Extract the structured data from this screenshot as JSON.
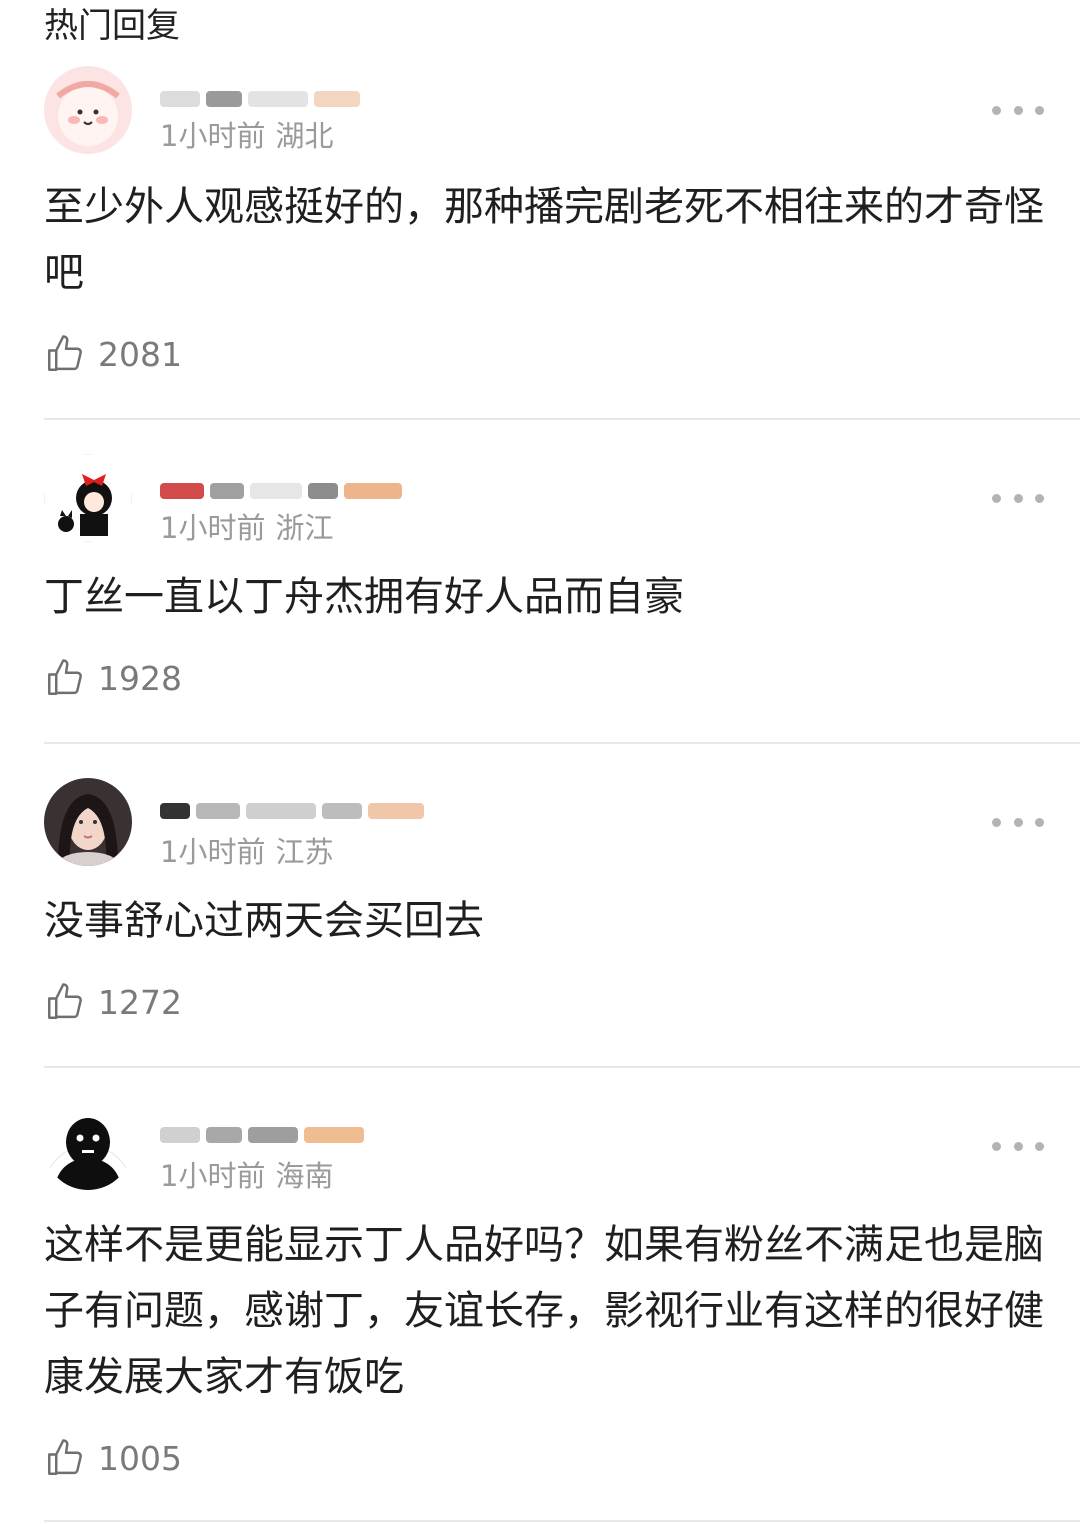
{
  "section_title": "热门回复",
  "comments": [
    {
      "time": "1小时前",
      "region": "湖北",
      "content": "至少外人观感挺好的，那种播完剧老死不相往来的才奇怪吧",
      "likes": "2081",
      "avatar_icon": "pink-cartoon-avatar-icon"
    },
    {
      "time": "1小时前",
      "region": "浙江",
      "content": "丁丝一直以丁舟杰拥有好人品而自豪",
      "likes": "1928",
      "avatar_icon": "kiki-cartoon-avatar-icon"
    },
    {
      "time": "1小时前",
      "region": "江苏",
      "content": "没事舒心过两天会买回去",
      "likes": "1272",
      "avatar_icon": "photo-avatar-icon"
    },
    {
      "time": "1小时前",
      "region": "海南",
      "content": "这样不是更能显示丁人品好吗？如果有粉丝不满足也是脑子有问题，感谢丁，友谊长存，影视行业有这样的很好健康发展大家才有饭吃",
      "likes": "1005",
      "avatar_icon": "black-figure-avatar-icon"
    }
  ],
  "colors": {
    "meta": "#9a9a9a",
    "divider": "#e8e8e8",
    "text": "#1f1f1f"
  }
}
